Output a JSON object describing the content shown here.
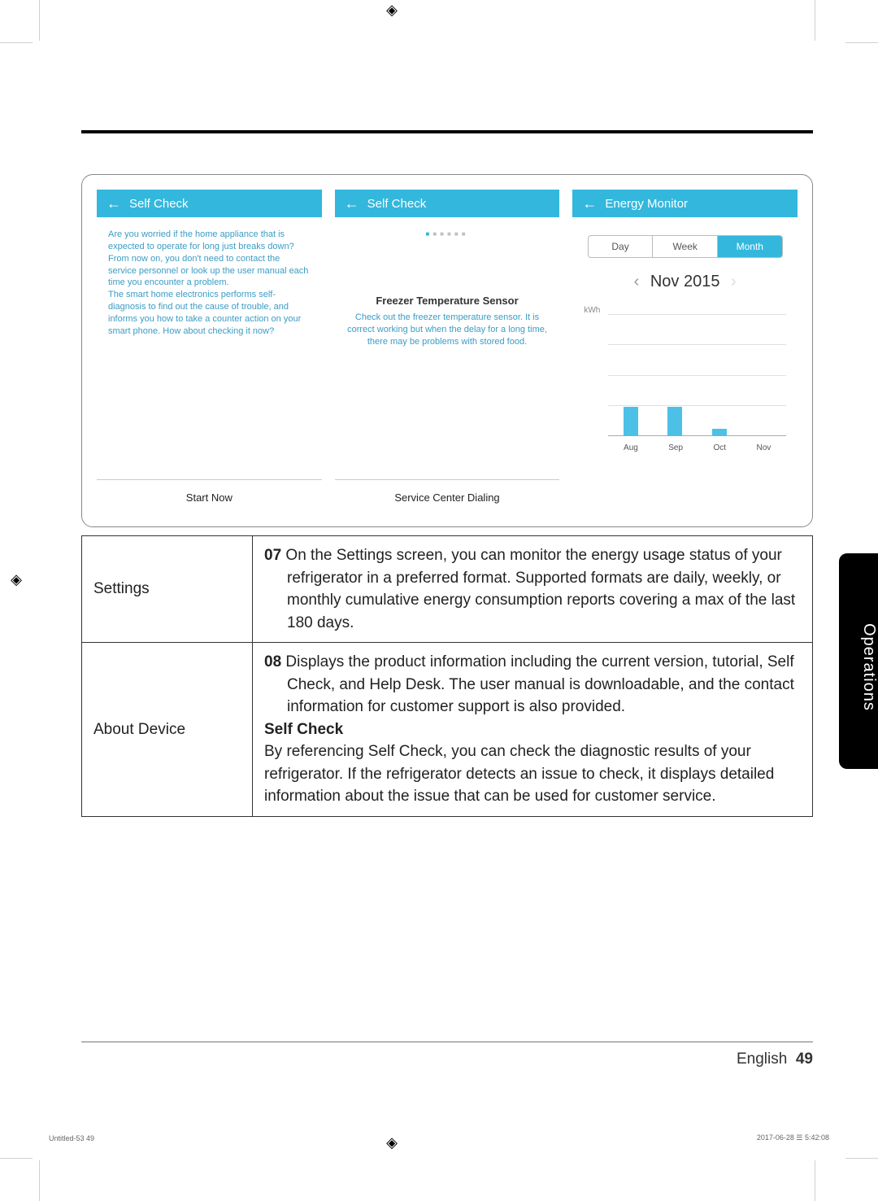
{
  "side_tab": "Operations",
  "screens": {
    "selfcheck1": {
      "title": "Self Check",
      "body": "Are you worried if the home appliance that is expected to operate for long just breaks down?\nFrom now on, you don't need to contact the service personnel or look up the user manual each time you encounter a problem.\nThe smart home electronics performs self-diagnosis to find out the cause of trouble, and informs you how to take a counter action on your smart phone. How about checking it now?",
      "button": "Start Now"
    },
    "selfcheck2": {
      "title": "Self Check",
      "sensor_title": "Freezer Temperature Sensor",
      "sensor_desc": "Check out the freezer temperature sensor. It is correct working but when the delay for a long time, there may be problems with stored food.",
      "button": "Service Center Dialing"
    },
    "energy": {
      "title": "Energy Monitor",
      "tabs": {
        "day": "Day",
        "week": "Week",
        "month": "Month"
      },
      "period": "Nov 2015",
      "ylabel": "kWh"
    }
  },
  "table": {
    "row1_label": "Settings",
    "row1_num": "07",
    "row1_text": "On the Settings screen, you can monitor the energy usage status of your refrigerator in a preferred format. Supported formats are daily, weekly, or monthly cumulative energy consumption reports covering a max of the last 180 days.",
    "row2_label": "About Device",
    "row2_num": "08",
    "row2_text": "Displays the product information including the current version, tutorial, Self Check, and Help Desk. The user manual is downloadable, and the contact information for customer support is also provided.",
    "row2_sub": "Self Check",
    "row2_text2": "By referencing Self Check, you can check the diagnostic results of your refrigerator. If the refrigerator detects an issue to check, it displays detailed information about the issue that can be used for customer service."
  },
  "footer": {
    "lang": "English",
    "page": "49"
  },
  "print": {
    "left": "Untitled-53   49",
    "right": "2017-06-28   ☰ 5:42:08"
  },
  "chart_data": {
    "type": "bar",
    "categories": [
      "Aug",
      "Sep",
      "Oct",
      "Nov"
    ],
    "values": [
      24,
      24,
      6,
      0
    ],
    "title": "Energy Monitor",
    "xlabel": "",
    "ylabel": "kWh",
    "ylim": [
      0,
      100
    ],
    "note": "Values are visual estimates of bar heights relative to an unlabeled y-axis; no numeric tick labels are shown in the source."
  }
}
